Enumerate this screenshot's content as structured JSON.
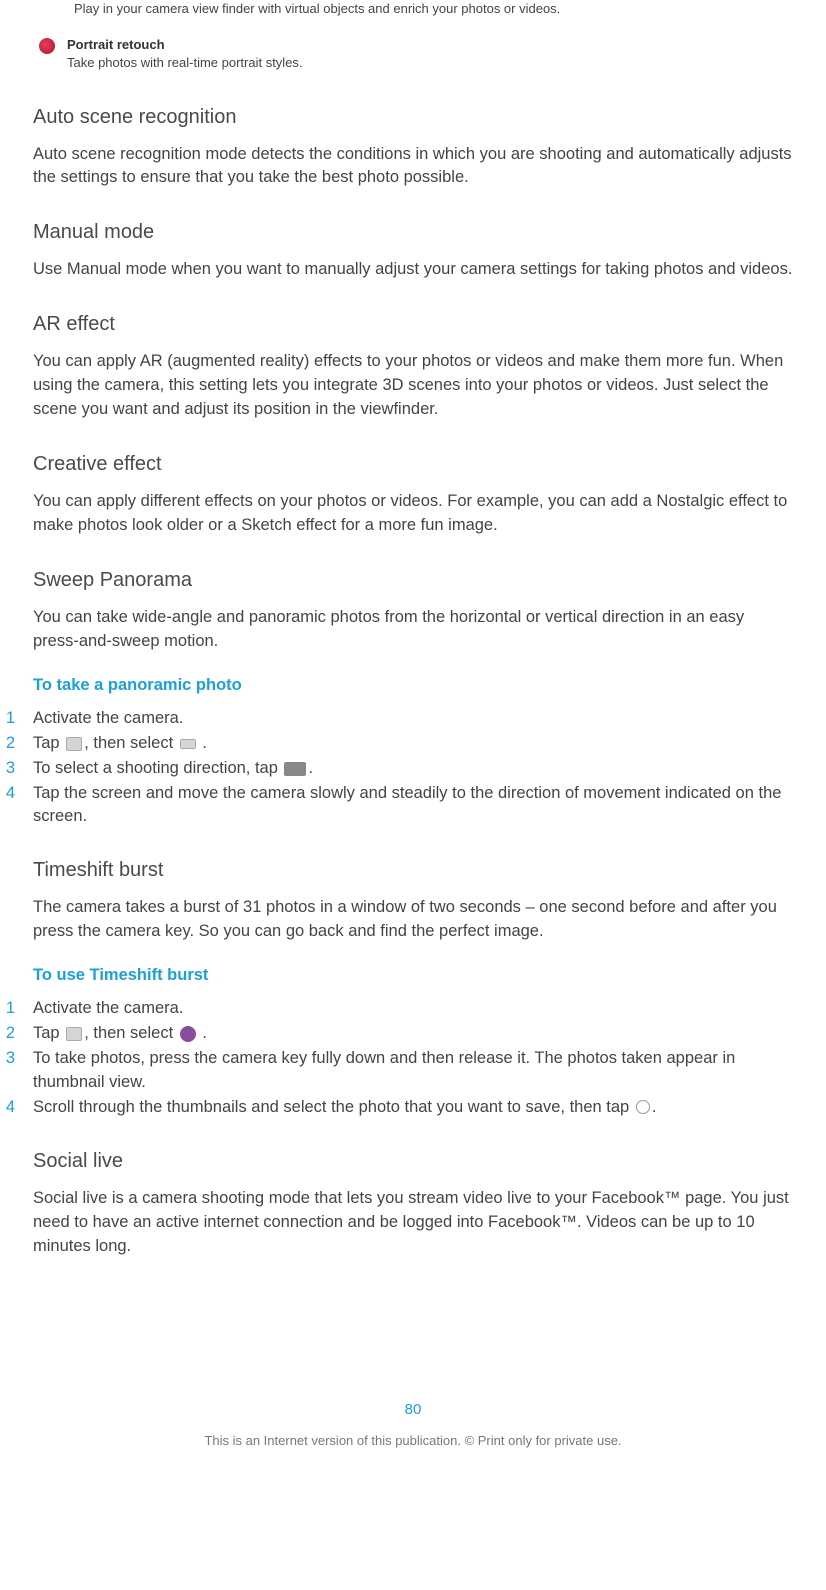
{
  "intro": "Play in your camera view finder with virtual objects and enrich your photos or videos.",
  "portrait": {
    "title": "Portrait retouch",
    "desc": "Take photos with real-time portrait styles."
  },
  "sections": {
    "auto_scene": {
      "heading": "Auto scene recognition",
      "body": "Auto scene recognition mode detects the conditions in which you are shooting and automatically adjusts the settings to ensure that you take the best photo possible."
    },
    "manual": {
      "heading": "Manual mode",
      "body": "Use Manual mode when you want to manually adjust your camera settings for taking photos and videos."
    },
    "ar": {
      "heading": "AR effect",
      "body": "You can apply AR (augmented reality) effects to your photos or videos and make them more fun. When using the camera, this setting lets you integrate 3D scenes into your photos or videos. Just select the scene you want and adjust its position in the viewfinder."
    },
    "creative": {
      "heading": "Creative effect",
      "body": "You can apply different effects on your photos or videos. For example, you can add a Nostalgic effect to make photos look older or a Sketch effect for a more fun image."
    },
    "sweep": {
      "heading": "Sweep Panorama",
      "body": "You can take wide-angle and panoramic photos from the horizontal or vertical direction in an easy press-and-sweep motion."
    },
    "timeshift": {
      "heading": "Timeshift burst",
      "body": "The camera takes a burst of 31 photos in a window of two seconds – one second before and after you press the camera key. So you can go back and find the perfect image."
    },
    "social": {
      "heading": "Social live",
      "body": "Social live is a camera shooting mode that lets you stream video live to your Facebook™ page. You just need to have an active internet connection and be logged into Facebook™. Videos can be up to 10 minutes long."
    }
  },
  "procedures": {
    "panoramic": {
      "heading": "To take a panoramic photo",
      "steps": {
        "s1": "Activate the camera.",
        "s2a": "Tap ",
        "s2b": ", then select ",
        "s2c": " .",
        "s3a": "To select a shooting direction, tap ",
        "s3b": ".",
        "s4": "Tap the screen and move the camera slowly and steadily to the direction of movement indicated on the screen."
      }
    },
    "timeshift": {
      "heading": "To use Timeshift burst",
      "steps": {
        "s1": "Activate the camera.",
        "s2a": "Tap ",
        "s2b": ", then select ",
        "s2c": " .",
        "s3": "To take photos, press the camera key fully down and then release it. The photos taken appear in thumbnail view.",
        "s4a": "Scroll through the thumbnails and select the photo that you want to save, then tap ",
        "s4b": "."
      }
    }
  },
  "page_number": "80",
  "footer": "This is an Internet version of this publication. © Print only for private use."
}
